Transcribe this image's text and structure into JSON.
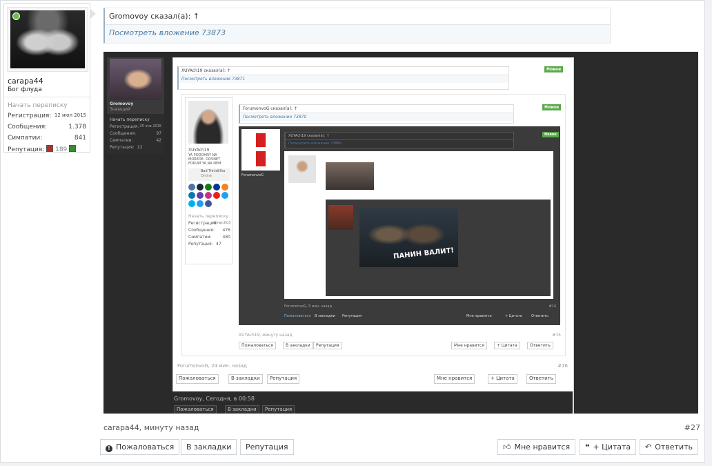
{
  "user": {
    "name": "carapa44",
    "title": "Бог флуда",
    "start_conversation": "Начать переписку",
    "stats": [
      {
        "label": "Регистрация:",
        "value": "12 июл 2015"
      },
      {
        "label": "Сообщения:",
        "value": "1.378"
      },
      {
        "label": "Симпатии:",
        "value": "841"
      }
    ],
    "reputation_label": "Репутация:",
    "reputation_value": "189"
  },
  "quote": {
    "header": "Gromovoy сказал(а): ↑",
    "attachment_link": "Посмотреть вложение 73873"
  },
  "embedded": {
    "l1_user_name": "Gromovoy",
    "l1_user_title": "Знающий",
    "l1_start": "Начать переписку",
    "l1_stats": [
      {
        "label": "Регистрация:",
        "value": "25 янв 2015"
      },
      {
        "label": "Сообщения:",
        "value": "97"
      },
      {
        "label": "Симпатии:",
        "value": "42"
      },
      {
        "label": "Репутация:",
        "value": "22"
      }
    ],
    "l1_quote_header": "XUYAch19 сказал(а): ↑",
    "l1_quote_link": "Посмотреть вложение 73871",
    "badge_new": "Новое",
    "l2_quote_header": "ForumonvoG сказал(а): ↑",
    "l2_quote_link": "Посмотреть вложение 73870",
    "l2_user_name": "XUYAch19",
    "l2_user_sig": "YA PODOHNY NA MOREDE. DOVNET FORUM YA NA NEM",
    "l2_user_online_name": "Bad Trinidillha",
    "l2_user_online": "Online",
    "l2_stats": [
      {
        "label": "Начать переписку",
        "value": ""
      },
      {
        "label": "Регистрация:",
        "value": "08 ноя 2015"
      },
      {
        "label": "Сообщения:",
        "value": "476"
      },
      {
        "label": "Симпатии:",
        "value": "480"
      },
      {
        "label": "Репутация:",
        "value": "47"
      }
    ],
    "l3_user_name": "ForumonvoG",
    "l3_quote_header": "XUYAch19 сказал(а): ↑",
    "l3_quote_link": "Посмотреть вложение 73869",
    "video_title": "ПАНИН ВАЛИТ!",
    "l3_footer_meta": "ForumonvoG, 5 мин. назад",
    "l3_footer_num": "#14",
    "l2_footer_meta": "XUYAch19, минуту назад",
    "l2_footer_num": "#15",
    "l1_footer_meta": "ForumonvoG, 24 мин. назад",
    "l1_footer_num": "#16",
    "bottom_meta": "Gromovoy, Сегодня, в 00:58",
    "btn_report": "Пожаловаться",
    "btn_bookmark": "В закладки",
    "btn_reputation": "Репутация",
    "btn_like": "Мне нравится",
    "btn_quote": "+ Цитата",
    "btn_reply": "Ответить"
  },
  "footer": {
    "meta": "carapa44, минуту назад",
    "post_number": "#27",
    "report": "Пожаловаться",
    "bookmark": "В закладки",
    "reputation": "Репутация",
    "like": "Мне нравится",
    "quote": "+ Цитата",
    "reply": "Ответить"
  }
}
